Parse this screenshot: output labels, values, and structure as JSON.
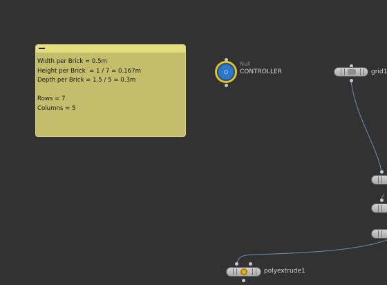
{
  "sticky_note": {
    "lines": [
      "Width per Brick = 0.5m",
      "Height per Brick  = 1 / 7 = 0.167m",
      "Depth per Brick = 1.5 / 5 = 0.3m",
      "",
      "Rows = 7",
      "Columns = 5"
    ]
  },
  "nodes": {
    "controller": {
      "type": "Null",
      "name": "CONTROLLER"
    },
    "grid": {
      "name": "grid1"
    },
    "polyextrude": {
      "name": "polyextrude1"
    }
  },
  "colors": {
    "background": "#323232",
    "sticky": "#c4bd6c",
    "wire": "#6e8fb4",
    "null_ring": "#e6c21a",
    "null_fill": "#2f78c8"
  },
  "icons": {
    "sticky_collapse": "minus-icon",
    "null": "null-target-icon",
    "grid": "grid-icon",
    "polyextrude": "polyextrude-icon"
  }
}
